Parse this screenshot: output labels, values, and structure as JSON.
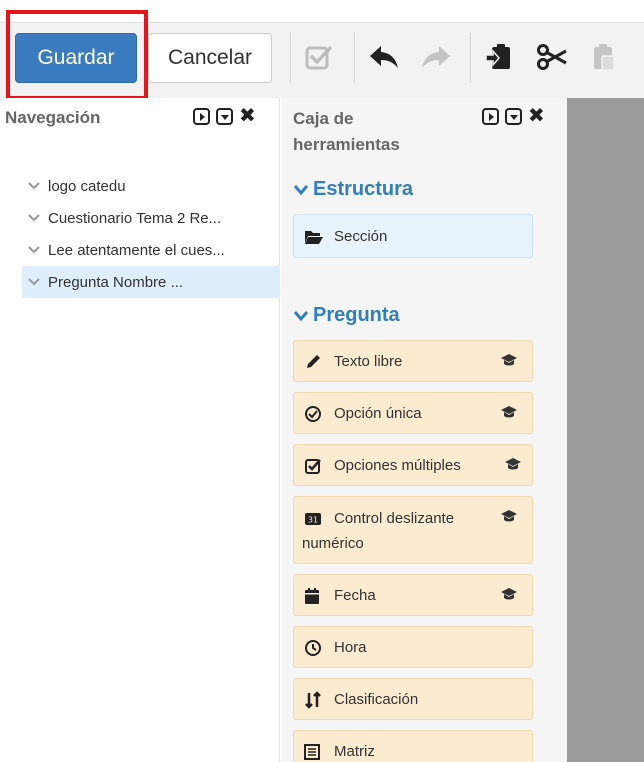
{
  "toolbar": {
    "save_label": "Guardar",
    "cancel_label": "Cancelar",
    "icons": [
      "check-icon",
      "undo-icon",
      "redo-icon",
      "paste-special-icon",
      "cut-icon",
      "paste-icon"
    ]
  },
  "navigation": {
    "title": "Navegación",
    "items": [
      {
        "label": "logo catedu"
      },
      {
        "label": "Cuestionario Tema 2 Re..."
      },
      {
        "label": "Lee atentamente el cues..."
      },
      {
        "label": "Pregunta Nombre ..."
      }
    ]
  },
  "toolbox": {
    "title_line1": "Caja de",
    "title_line2": "herramientas",
    "structure_section": "Estructura",
    "structure_items": [
      {
        "label": "Sección"
      }
    ],
    "question_section": "Pregunta",
    "question_items": [
      {
        "label": "Texto libre"
      },
      {
        "label": "Opción única"
      },
      {
        "label": "Opciones múltiples"
      },
      {
        "label_line1": "Control deslizante",
        "label_line2": "numérico"
      },
      {
        "label": "Fecha"
      },
      {
        "label": "Hora"
      },
      {
        "label": "Clasificación"
      },
      {
        "label": "Matriz"
      }
    ]
  },
  "colors": {
    "primary": "#3b7bbf",
    "highlight": "#e8141b",
    "section_heading": "#2f7fc1",
    "question_item_bg": "#fcebd0",
    "structure_item_bg": "#e8f2fb",
    "selected_nav_bg": "#deeefc"
  }
}
